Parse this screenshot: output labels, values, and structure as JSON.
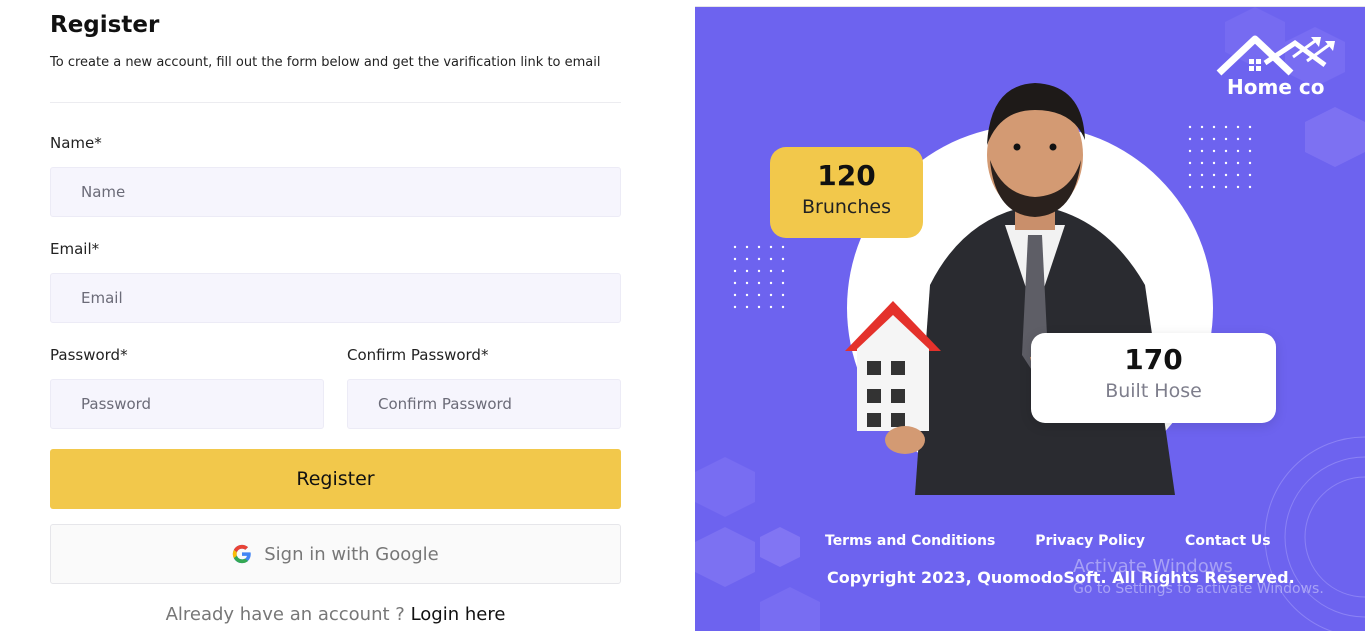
{
  "form": {
    "title": "Register",
    "subtitle": "To create a new account, fill out the form below and get the varification link to email",
    "name_label": "Name*",
    "name_placeholder": "Name",
    "email_label": "Email*",
    "email_placeholder": "Email",
    "password_label": "Password*",
    "password_placeholder": "Password",
    "confirm_label": "Confirm Password*",
    "confirm_placeholder": "Confirm Password",
    "register_label": "Register",
    "google_label": "Sign in with Google",
    "already_text": "Already have an account ?",
    "login_link": "Login here"
  },
  "side": {
    "brand": "Home co",
    "stat1": {
      "value": "120",
      "label": "Brunches"
    },
    "stat2": {
      "value": "170",
      "label": "Built Hose"
    },
    "footer_links": [
      "Terms and Conditions",
      "Privacy Policy",
      "Contact Us"
    ],
    "copyright": "Copyright 2023, QuomodoSoft. All Rights Reserved.",
    "watermark_title": "Activate Windows",
    "watermark_sub": "Go to Settings to activate Windows."
  },
  "colors": {
    "accent_yellow": "#f2c84b",
    "panel_purple": "#6d63ef",
    "input_bg": "#f6f5fd"
  },
  "icons": {
    "google": "google-icon",
    "logo": "house-arrow-logo-icon"
  }
}
